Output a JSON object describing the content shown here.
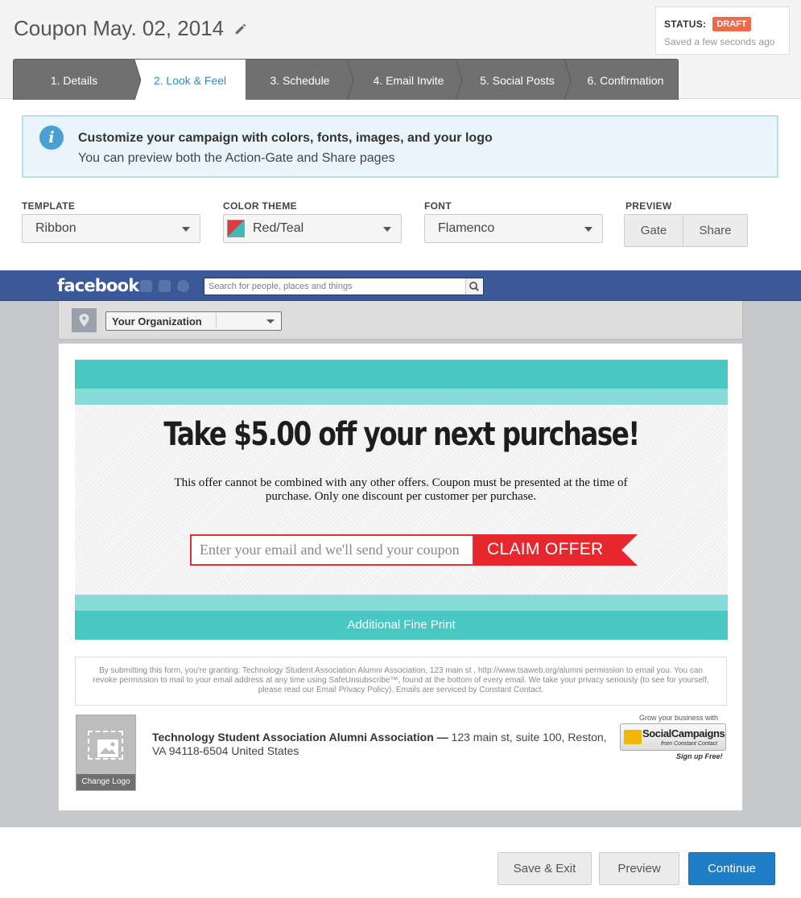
{
  "header": {
    "title": "Coupon May. 02, 2014",
    "status_label": "STATUS:",
    "status_badge": "DRAFT",
    "saved_text": "Saved a few seconds ago"
  },
  "wizard": {
    "steps": [
      "1. Details",
      "2. Look & Feel",
      "3. Schedule",
      "4. Email Invite",
      "5. Social Posts",
      "6. Confirmation"
    ],
    "active_index": 1
  },
  "info": {
    "title": "Customize your campaign with colors, fonts, images, and your logo",
    "subtitle": "You can preview both the Action-Gate and Share pages"
  },
  "selectors": {
    "template": {
      "label": "TEMPLATE",
      "value": "Ribbon"
    },
    "color_theme": {
      "label": "COLOR THEME",
      "value": "Red/Teal"
    },
    "font": {
      "label": "FONT",
      "value": "Flamenco"
    },
    "preview": {
      "label": "PREVIEW",
      "gate": "Gate",
      "share": "Share"
    }
  },
  "facebook": {
    "logo": "facebook",
    "search_placeholder": "Search for people, places and things",
    "org_select": "Your Organization"
  },
  "coupon": {
    "headline": "Take $5.00 off your next purchase!",
    "description": "This offer cannot be combined with any other offers. Coupon must be presented at the time of purchase. Only one discount per customer per purchase.",
    "email_placeholder": "Enter your email and we'll send your coupon",
    "claim_button": "CLAIM OFFER",
    "fine_print": "Additional Fine Print"
  },
  "legal": {
    "text": "By submitting this form, you're granting: Technology Student Association Alumni Association, 123 main st , http://www.tsaweb.org/alumni permission to email you. You can revoke permission to mail to your email address at any time using SafeUnsubscribe™, found at the bottom of every email. We take your privacy seriously (to see for yourself, please read our Email Privacy Policy). Emails are serviced by Constant Contact."
  },
  "footer_org": {
    "change_logo": "Change Logo",
    "org_name": "Technology Student Association Alumni Association —",
    "address": " 123 main st, suite 100, Reston, VA 94118-6504 United States",
    "badge_top": "Grow your business with",
    "badge_name": "SocialCampaigns",
    "badge_sub": "from Constant Contact",
    "badge_signup": "Sign up Free!"
  },
  "actions": {
    "save_exit": "Save & Exit",
    "preview": "Preview",
    "continue": "Continue"
  },
  "colors": {
    "teal_dark": "#49c8c3",
    "teal_light": "#85dbd7",
    "red": "#e8262d",
    "primary_blue": "#1f7ec6",
    "draft_orange": "#ef6a4b",
    "facebook_blue": "#3b5998"
  },
  "icons": {
    "title_edit": "pencil-icon",
    "info": "info-icon",
    "location": "pin-icon",
    "logo_placeholder": "image-icon",
    "search": "search-icon"
  }
}
